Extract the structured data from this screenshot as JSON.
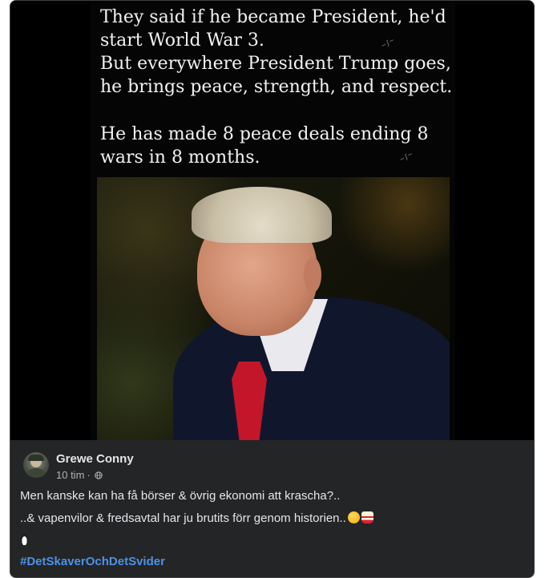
{
  "post": {
    "image": {
      "text_block_1": "They said if he became President, he'd\nstart World War 3.\nBut everywhere President Trump goes,\nhe brings peace, strength, and respect.",
      "text_block_2": "He has made 8 peace deals ending 8\nwars in 8 months."
    },
    "author": {
      "name": "Grewe Conny"
    },
    "meta": {
      "time": "10 tim",
      "separator": "·",
      "audience_icon": "globe-icon"
    },
    "body": {
      "line1": "Men kanske kan ha få börser & övrig ekonomi att krascha?..",
      "line2": "..& vapenvilor & fredsavtal har ju brutits förr genom historien..",
      "line2_emojis": [
        "relieved-face-icon",
        "popcorn-icon"
      ],
      "line3_emoji": "penguin-icon"
    },
    "hashtag": "#DetSkaverOchDetSvider"
  },
  "colors": {
    "card_bg": "#242526",
    "text_primary": "#e4e6eb",
    "text_secondary": "#b0b3b8",
    "hashtag": "#4b93e8"
  }
}
